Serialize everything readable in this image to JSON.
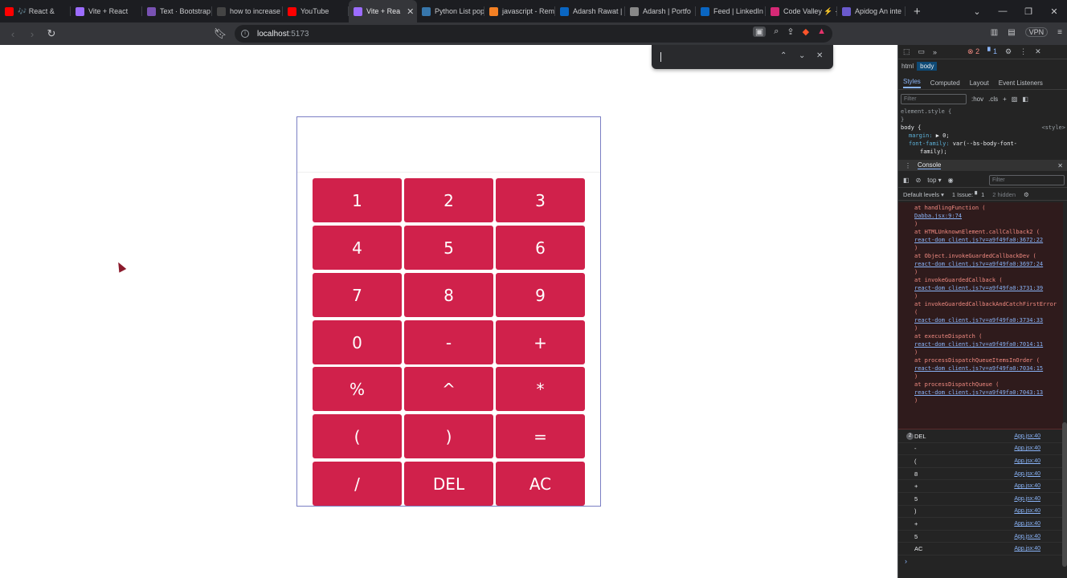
{
  "browser": {
    "tabs": [
      {
        "label": "🎶 React &",
        "icon": "youtube-icon",
        "color": "#ff0000"
      },
      {
        "label": "Vite + React",
        "icon": "vite-icon",
        "color": "#9c6cff"
      },
      {
        "label": "Text · Bootstrap",
        "icon": "bootstrap-icon",
        "color": "#7952b3"
      },
      {
        "label": "how to increase",
        "icon": "github-icon",
        "color": "#444"
      },
      {
        "label": "YouTube",
        "icon": "youtube-icon",
        "color": "#ff0000"
      },
      {
        "label": "Vite + Rea",
        "icon": "vite-icon",
        "color": "#9c6cff",
        "active": true
      },
      {
        "label": "Python List pop",
        "icon": "python-icon",
        "color": "#3776ab"
      },
      {
        "label": "javascript - Rem",
        "icon": "stackoverflow-icon",
        "color": "#f48024"
      },
      {
        "label": "Adarsh Rawat |",
        "icon": "linkedin-icon",
        "color": "#0a66c2"
      },
      {
        "label": "Adarsh | Portfo",
        "icon": "portfolio-icon",
        "color": "#888"
      },
      {
        "label": "Feed | LinkedIn",
        "icon": "linkedin-icon",
        "color": "#0a66c2"
      },
      {
        "label": "Code Valley ⚡ ·",
        "icon": "instagram-icon",
        "color": "#d62976"
      },
      {
        "label": "Apidog An inte",
        "icon": "apidog-icon",
        "color": "#6a5acd"
      }
    ],
    "url_host": "localhost",
    "url_port": ":5173",
    "vpn_label": "VPN"
  },
  "calculator": {
    "display": "",
    "keys": [
      "1",
      "2",
      "3",
      "4",
      "5",
      "6",
      "7",
      "8",
      "9",
      "0",
      "-",
      "+",
      "%",
      "^",
      "*",
      "(",
      ")",
      "=",
      "/",
      "DEL",
      "AC"
    ],
    "key_color": "#d0214b"
  },
  "devtools": {
    "error_count": "2",
    "info_count": "1",
    "breadcrumb": [
      "html",
      "body"
    ],
    "subtabs": [
      "Styles",
      "Computed",
      "Layout",
      "Event Listeners"
    ],
    "filter_placeholder": "Filter",
    "hov": ":hov",
    "cls": ".cls",
    "styles_lines": {
      "element_style": "element.style {",
      "close1": "}",
      "body_sel": "body {",
      "style_link": "<style>",
      "margin_prop": "margin:",
      "margin_val": "▶ 0;",
      "font_prop": "font-family:",
      "font_val": "var(--bs-body-font-",
      "font_val2": "family);"
    },
    "console_tab": "Console",
    "context": "top ▾",
    "console_filter": "Filter",
    "levels": "Default levels ▾",
    "issues": "1 Issue: ▘ 1",
    "hidden": "2 hidden",
    "stack": [
      {
        "text": "at handlingFunction (",
        "link": "Dabba.jsx:9:74",
        "close": ")"
      },
      {
        "text": "at HTMLUnknownElement.callCallback2 (",
        "link": "react-dom_client.js?v=a9f49fa0:3672:22",
        "close": ")"
      },
      {
        "text": "at Object.invokeGuardedCallbackDev (",
        "link": "react-dom_client.js?v=a9f49fa0:3697:24",
        "close": ")"
      },
      {
        "text": "at invokeGuardedCallback (",
        "link": "react-dom_client.js?v=a9f49fa0:3731:39",
        "close": ")"
      },
      {
        "text": "at invokeGuardedCallbackAndCatchFirstError (",
        "link": "react-dom_client.js?v=a9f49fa0:3734:33",
        "close": ")"
      },
      {
        "text": "at executeDispatch (",
        "link": "react-dom_client.js?v=a9f49fa0:7014:11",
        "close": ")"
      },
      {
        "text": "at processDispatchQueueItemsInOrder (",
        "link": "react-dom_client.js?v=a9f49fa0:7034:15",
        "close": ")"
      },
      {
        "text": "at processDispatchQueue (",
        "link": "react-dom_client.js?v=a9f49fa0:7043:13",
        "close": ")"
      }
    ],
    "logs": [
      {
        "value": "DEL",
        "src": "App.jsx:40",
        "badge": "2"
      },
      {
        "value": "-",
        "src": "App.jsx:40"
      },
      {
        "value": "(",
        "src": "App.jsx:40"
      },
      {
        "value": "8",
        "src": "App.jsx:40"
      },
      {
        "value": "+",
        "src": "App.jsx:40"
      },
      {
        "value": "5",
        "src": "App.jsx:40"
      },
      {
        "value": ")",
        "src": "App.jsx:40"
      },
      {
        "value": "+",
        "src": "App.jsx:40"
      },
      {
        "value": "5",
        "src": "App.jsx:40"
      },
      {
        "value": "AC",
        "src": "App.jsx:40"
      }
    ],
    "prompt": "›"
  }
}
